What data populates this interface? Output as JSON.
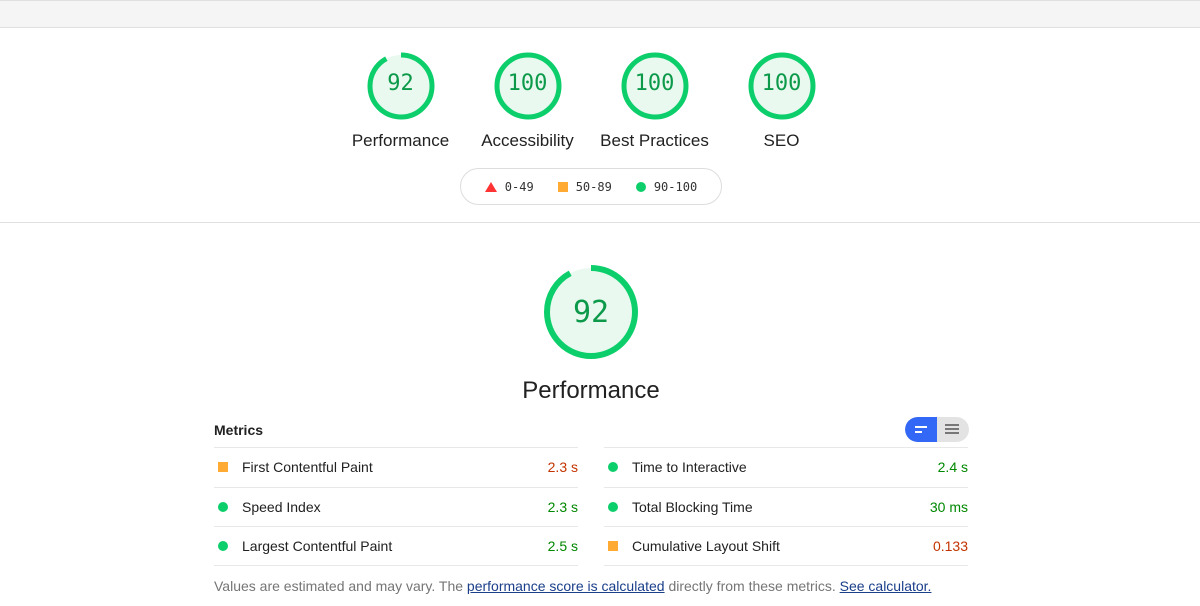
{
  "categories": [
    {
      "label": "Performance",
      "score": "92",
      "fraction": 0.92
    },
    {
      "label": "Accessibility",
      "score": "100",
      "fraction": 1
    },
    {
      "label": "Best Practices",
      "score": "100",
      "fraction": 1
    },
    {
      "label": "SEO",
      "score": "100",
      "fraction": 1
    }
  ],
  "legend": [
    {
      "icon": "triangle",
      "range": "0-49",
      "color": "#ff3333"
    },
    {
      "icon": "square",
      "range": "50-89",
      "color": "#ffaa33"
    },
    {
      "icon": "circle",
      "range": "90-100",
      "color": "#0cce6b"
    }
  ],
  "main": {
    "score": "92",
    "fraction": 0.92,
    "title": "Performance"
  },
  "metrics": {
    "heading": "Metrics",
    "left": [
      {
        "name": "First Contentful Paint",
        "value": "2.3 s",
        "status": "average"
      },
      {
        "name": "Speed Index",
        "value": "2.3 s",
        "status": "pass"
      },
      {
        "name": "Largest Contentful Paint",
        "value": "2.5 s",
        "status": "pass"
      }
    ],
    "right": [
      {
        "name": "Time to Interactive",
        "value": "2.4 s",
        "status": "pass"
      },
      {
        "name": "Total Blocking Time",
        "value": "30 ms",
        "status": "pass"
      },
      {
        "name": "Cumulative Layout Shift",
        "value": "0.133",
        "status": "average"
      }
    ]
  },
  "footer": {
    "text1": "Values are estimated and may vary. The ",
    "link1": "performance score is calculated",
    "text2": " directly from these metrics. ",
    "link2": "See calculator."
  },
  "colors": {
    "pass": "#0cce6b",
    "average": "#ffaa33",
    "fail": "#ff3333"
  }
}
